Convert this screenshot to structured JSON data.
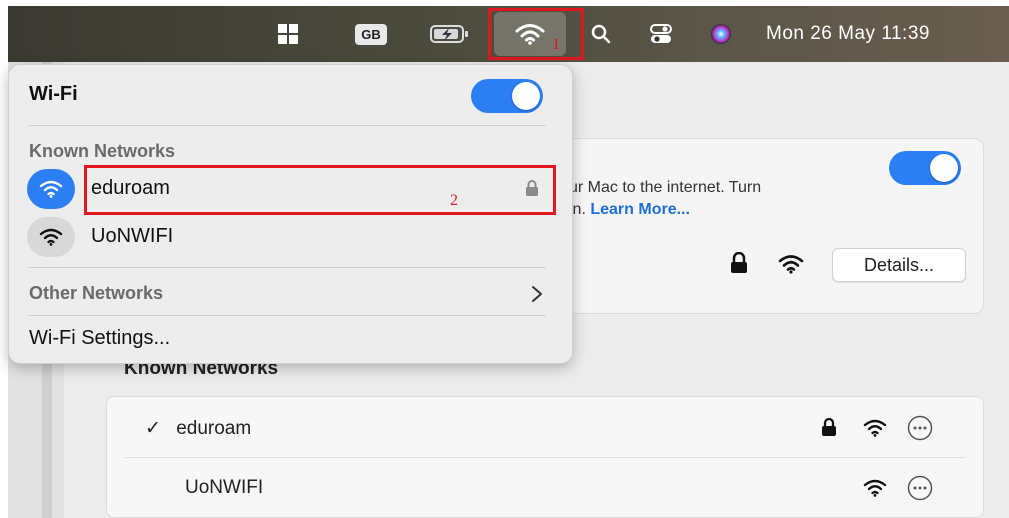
{
  "menubar": {
    "keyboard_layout": "GB",
    "clock": "Mon 26 May  11:39",
    "icons": [
      "window-grid-icon",
      "keyboard-layout-badge",
      "battery-charging-icon",
      "wifi-icon",
      "search-icon",
      "control-center-icon",
      "siri-icon"
    ]
  },
  "annotations": {
    "one": "1",
    "two": "2"
  },
  "wifi_menu": {
    "title": "Wi-Fi",
    "wifi_enabled": true,
    "known_label": "Known Networks",
    "known": [
      {
        "name": "eduroam",
        "locked": true,
        "connected": true
      },
      {
        "name": "UoNWIFI",
        "locked": false,
        "connected": false
      }
    ],
    "other_label": "Other Networks",
    "settings_label": "Wi-Fi Settings..."
  },
  "settings_pane": {
    "desc_line1": "ur Mac to the internet. Turn",
    "desc_line2_prefix": "in.",
    "learn_more": "Learn More...",
    "details_button": "Details...",
    "known_title": "Known Networks",
    "known": [
      {
        "check": "✓",
        "name": "eduroam",
        "locked": true
      },
      {
        "name": "UoNWIFI",
        "locked": false
      }
    ]
  },
  "colors": {
    "accent": "#2b7ff2",
    "annotation_red": "#e0171f"
  }
}
